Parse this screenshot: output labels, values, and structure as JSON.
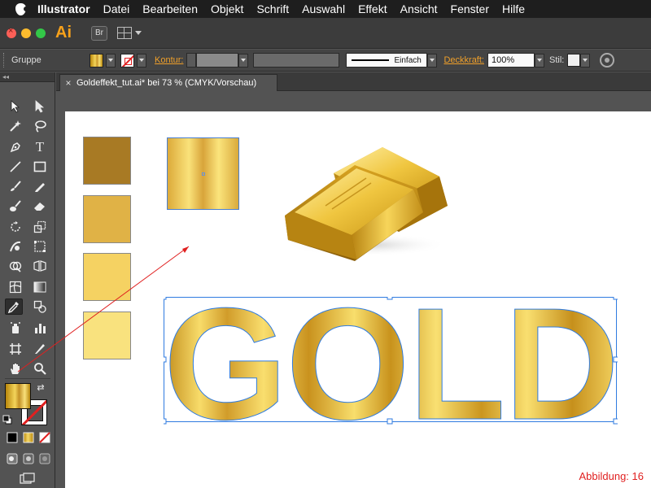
{
  "menu": {
    "app_name": "Illustrator",
    "items": [
      "Datei",
      "Bearbeiten",
      "Objekt",
      "Schrift",
      "Auswahl",
      "Effekt",
      "Ansicht",
      "Fenster",
      "Hilfe"
    ]
  },
  "appbar": {
    "logo": "Ai",
    "bridge": "Br"
  },
  "control": {
    "selection_label": "Gruppe",
    "stroke_label": "Kontur:",
    "stroke_profile": "Einfach",
    "opacity_label": "Deckkraft:",
    "opacity_value": "100%",
    "style_label": "Stil:"
  },
  "document": {
    "tab_title": "Goldeffekt_tut.ai* bei 73 % (CMYK/Vorschau)"
  },
  "artwork": {
    "swatch_colors": [
      "#a87a24",
      "#e0b246",
      "#f5d262",
      "#f9e27e"
    ],
    "logo_text": "GOLD",
    "caption": "Abbildung: 16"
  },
  "colors": {
    "accent_orange": "#f0a02a",
    "selection_blue": "#2f7be0",
    "arrow_red": "#e02020"
  }
}
